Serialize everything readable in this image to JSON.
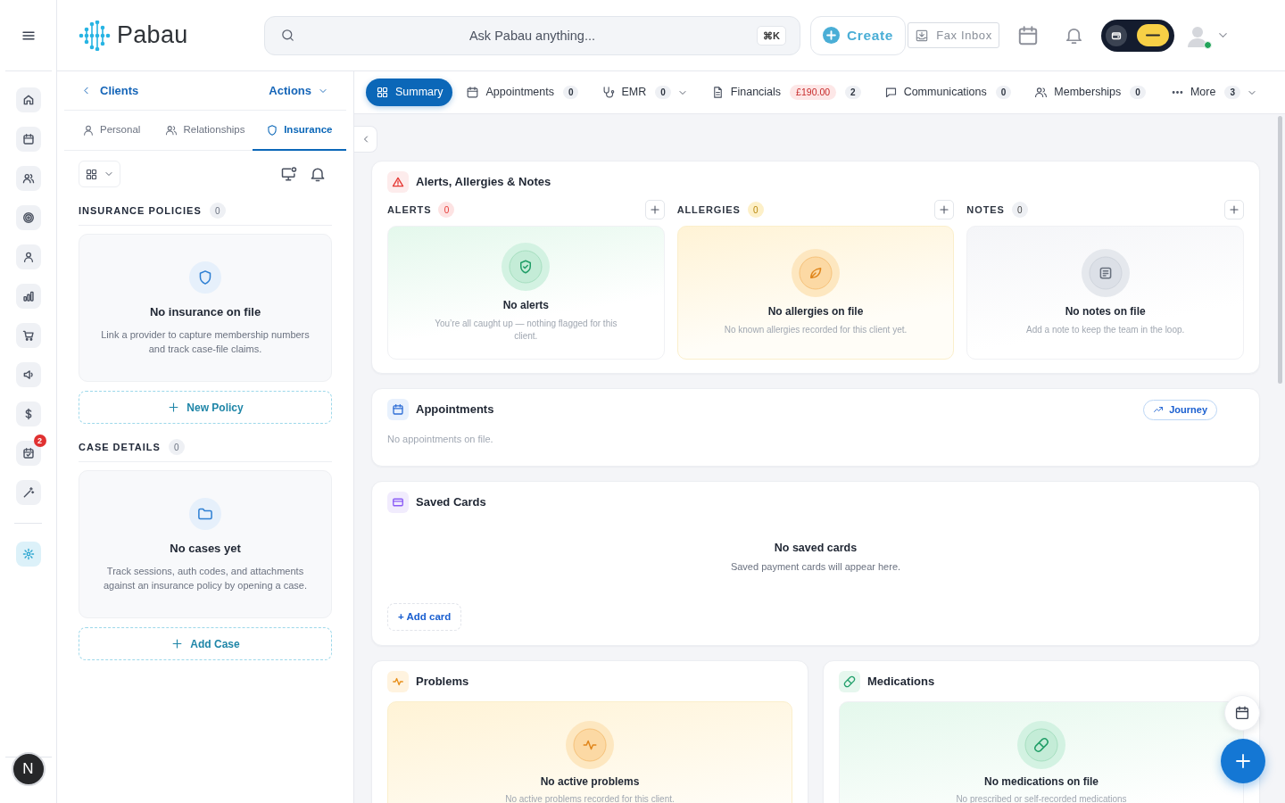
{
  "rail": {
    "items": [
      {
        "kind": "home",
        "selected": false
      },
      {
        "kind": "calendar",
        "selected": false
      },
      {
        "kind": "users",
        "selected": false
      },
      {
        "kind": "target",
        "selected": false
      },
      {
        "kind": "user",
        "selected": false
      },
      {
        "kind": "chart",
        "selected": false
      },
      {
        "kind": "cart",
        "selected": false
      },
      {
        "kind": "megaphone",
        "selected": false
      },
      {
        "kind": "dollar",
        "selected": false
      },
      {
        "kind": "tasks",
        "selected": false,
        "badge": "2"
      },
      {
        "kind": "wand",
        "selected": false
      }
    ],
    "extras": [
      {
        "kind": "sparkle",
        "selected": true
      }
    ],
    "user_initial": "N"
  },
  "header": {
    "brand": "Pabau",
    "search": {
      "placeholder": "Ask Pabau anything...",
      "shortcut": "⌘K"
    },
    "create_button": "Create",
    "fax_button": "Fax Inbox",
    "avatar": {
      "online": true
    }
  },
  "client_panel": {
    "back_link": "Clients",
    "actions_button": "Actions",
    "tabs": [
      {
        "label": "Personal",
        "kind": "user",
        "selected": false
      },
      {
        "label": "Relationships",
        "kind": "users",
        "selected": false
      },
      {
        "label": "Insurance",
        "kind": "shield",
        "selected": true
      }
    ],
    "sections": [
      {
        "title": "INSURANCE POLICIES",
        "count": "0",
        "kind": "shield",
        "empty_title": "No insurance on file",
        "empty_text": "Link a provider to capture membership numbers and track case-file claims.",
        "button": "New Policy"
      },
      {
        "title": "CASE DETAILS",
        "count": "0",
        "kind": "folder",
        "empty_title": "No cases yet",
        "empty_text": "Track sessions, auth codes, and attachments against an insurance policy by opening a case.",
        "button": "Add Case"
      }
    ]
  },
  "main_tabs": [
    {
      "label": "Summary",
      "kind": "grid",
      "selected": true,
      "has_menu": false
    },
    {
      "label": "Appointments",
      "kind": "calendar",
      "count": "0",
      "selected": false,
      "has_menu": false
    },
    {
      "label": "EMR",
      "kind": "stethoscope",
      "count": "0",
      "selected": false,
      "has_menu": true
    },
    {
      "label": "Financials",
      "kind": "document",
      "amount": "£190.00",
      "count": "2",
      "selected": false,
      "has_menu": false
    },
    {
      "label": "Communications",
      "kind": "chat",
      "count": "0",
      "selected": false,
      "has_menu": false
    },
    {
      "label": "Memberships",
      "kind": "users",
      "count": "0",
      "selected": false,
      "has_menu": false
    },
    {
      "label": "More",
      "kind": "dots",
      "count": "3",
      "selected": false,
      "has_menu": true
    }
  ],
  "alerts_card": {
    "title": "Alerts, Allergies & Notes",
    "columns": [
      {
        "kind": "alerts",
        "label": "ALERTS",
        "count": "0",
        "empty_title": "No alerts",
        "empty_text": "You’re all caught up — nothing flagged for this client."
      },
      {
        "kind": "allergies",
        "label": "ALLERGIES",
        "count": "0",
        "empty_title": "No allergies on file",
        "empty_text": "No known allergies recorded for this client yet."
      },
      {
        "kind": "notes",
        "label": "NOTES",
        "count": "0",
        "empty_title": "No notes on file",
        "empty_text": "Add a note to keep the team in the loop."
      }
    ]
  },
  "appointments_card": {
    "title": "Appointments",
    "journey_button": "Journey",
    "empty_text": "No appointments on file."
  },
  "saved_cards_card": {
    "title": "Saved Cards",
    "empty_title": "No saved cards",
    "empty_text": "Saved payment cards will appear here.",
    "add_button": "+ Add card"
  },
  "clinical_cards": [
    {
      "kind": "problems",
      "title": "Problems",
      "empty_title": "No active problems",
      "empty_text": "No active problems recorded for this client."
    },
    {
      "kind": "medications",
      "title": "Medications",
      "empty_title": "No medications on file",
      "empty_text": "No prescribed or self-recorded medications"
    }
  ]
}
